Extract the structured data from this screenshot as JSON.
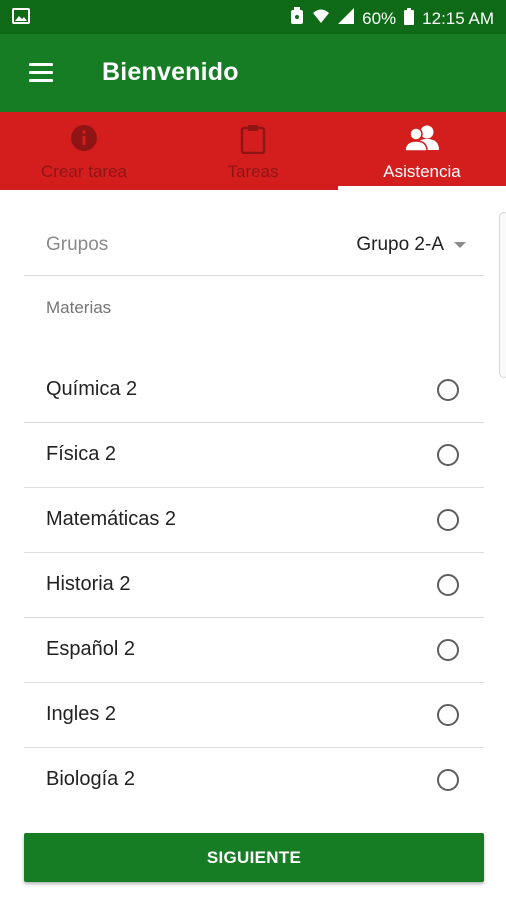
{
  "status_bar": {
    "battery": "60%",
    "time": "12:15 AM",
    "icons": [
      "image-icon",
      "notification-icon",
      "wifi-icon",
      "signal-icon",
      "battery-icon"
    ]
  },
  "app_bar": {
    "title": "Bienvenido",
    "color": "#177d24"
  },
  "tabs": [
    {
      "label": "Crear tarea",
      "icon": "info-icon",
      "active": false
    },
    {
      "label": "Tareas",
      "icon": "clipboard-icon",
      "active": false
    },
    {
      "label": "Asistencia",
      "icon": "people-icon",
      "active": true
    }
  ],
  "tab_color": "#d41e1e",
  "groups": {
    "label": "Grupos",
    "selected": "Grupo 2-A"
  },
  "subjects": {
    "label": "Materias",
    "items": [
      {
        "name": "Química 2",
        "selected": false
      },
      {
        "name": "Física 2",
        "selected": false
      },
      {
        "name": "Matemáticas 2",
        "selected": false
      },
      {
        "name": "Historia 2",
        "selected": false
      },
      {
        "name": "Español 2",
        "selected": false
      },
      {
        "name": "Ingles 2",
        "selected": false
      },
      {
        "name": "Biología 2",
        "selected": false
      }
    ]
  },
  "next_button": {
    "label": "SIGUIENTE"
  }
}
